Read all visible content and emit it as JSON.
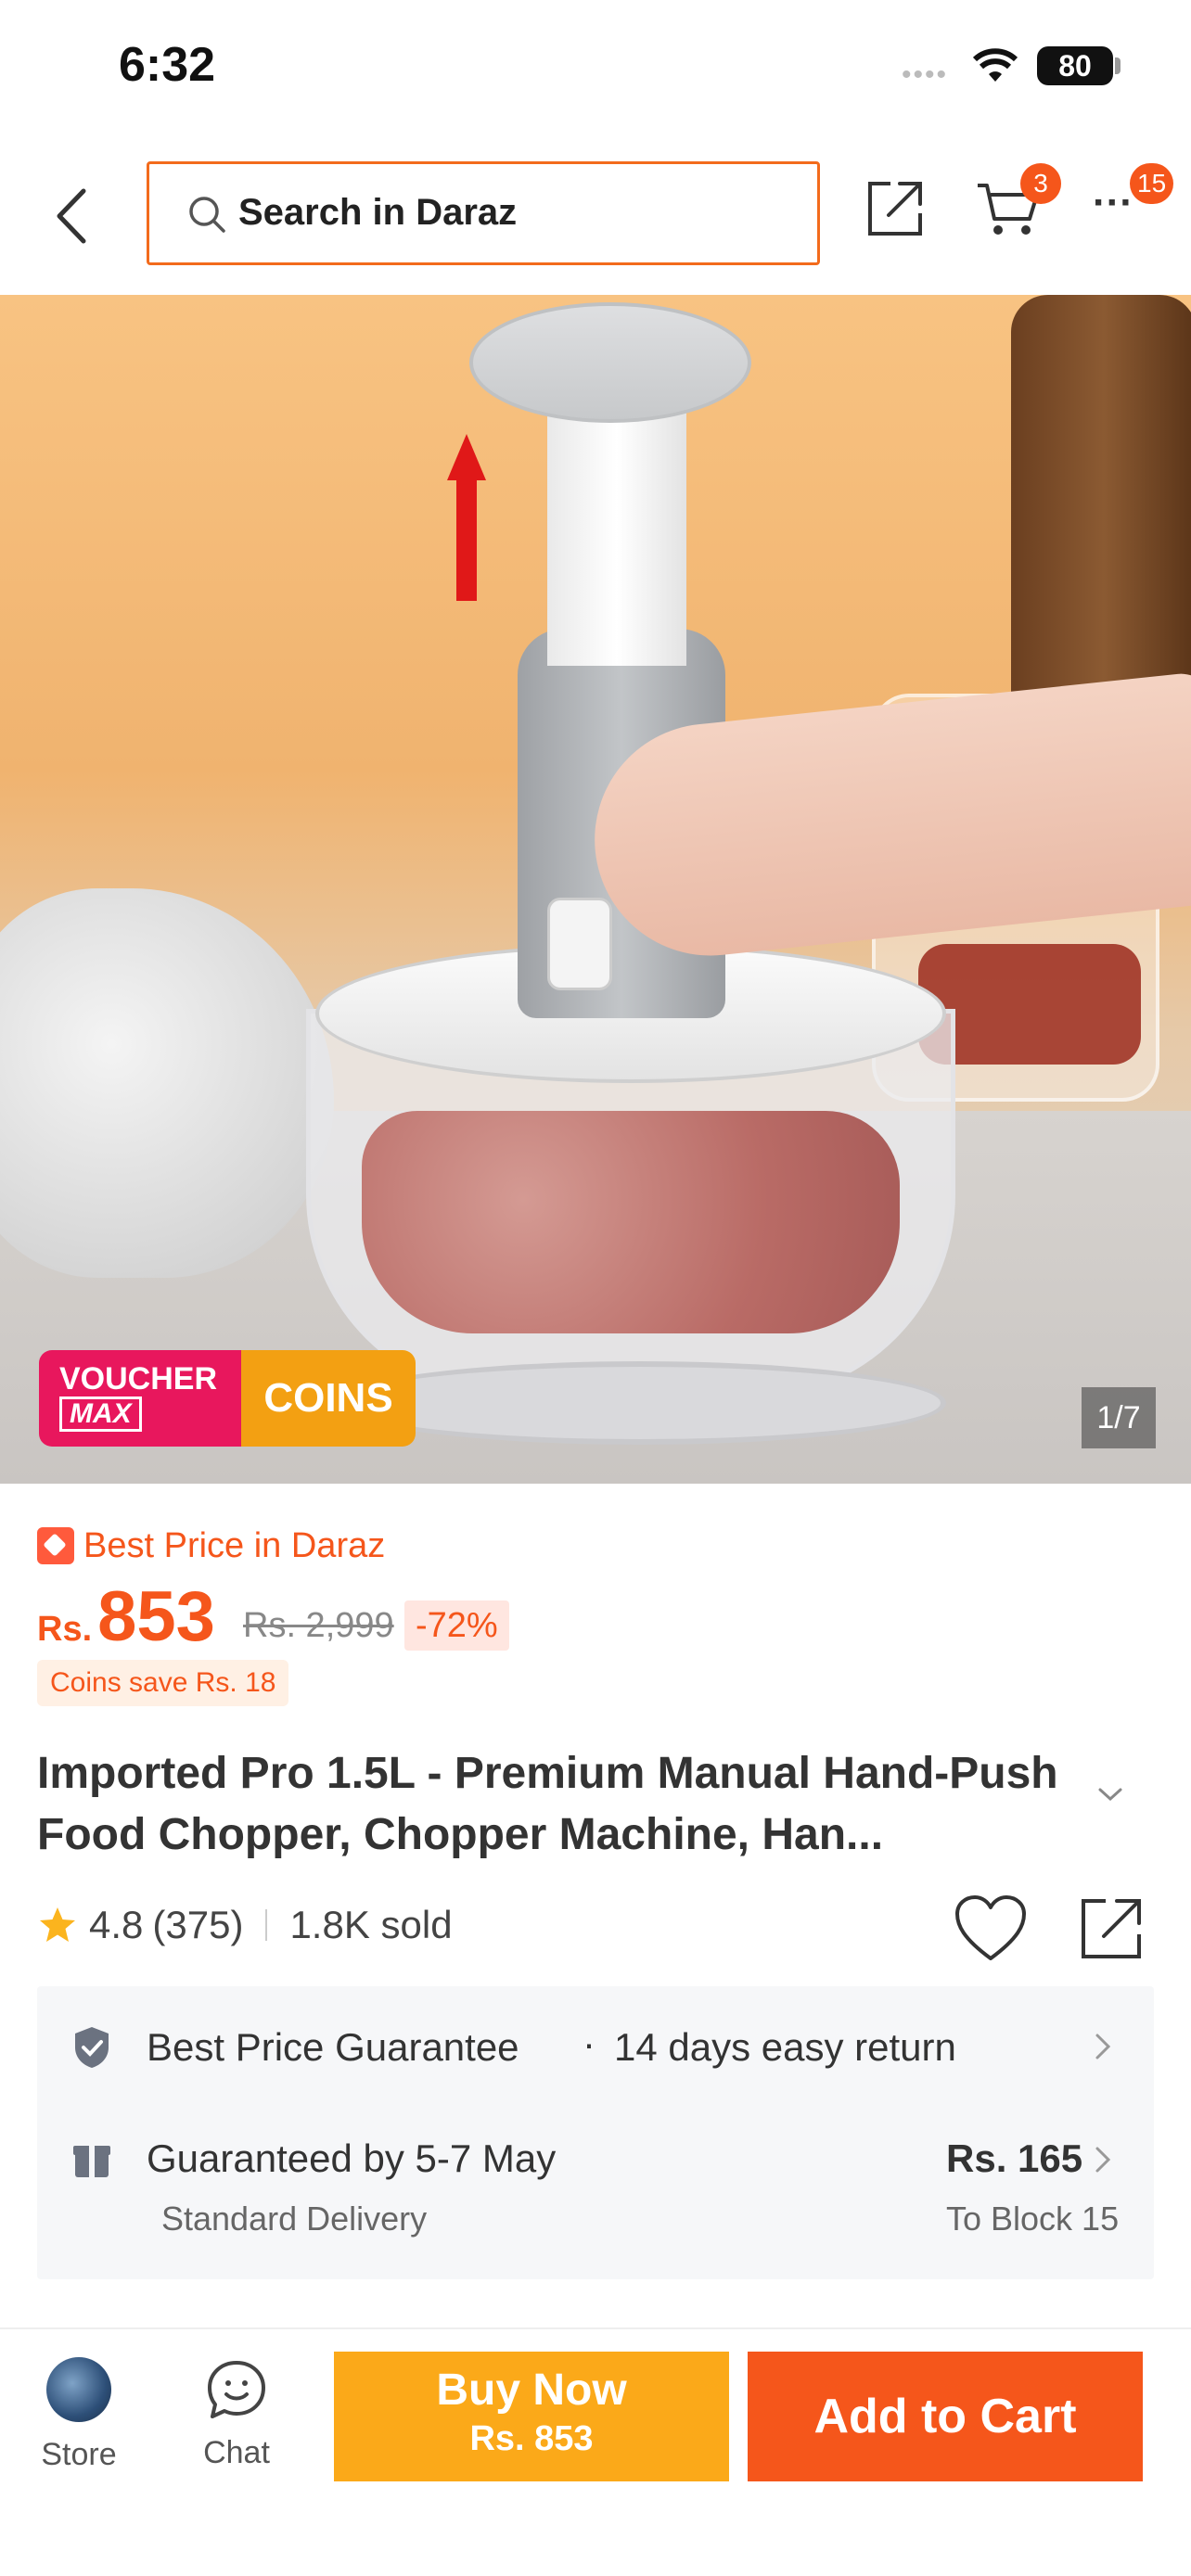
{
  "status_bar": {
    "time": "6:32",
    "battery": "80"
  },
  "header": {
    "search_placeholder": "Search in Daraz",
    "cart_badge": "3",
    "more_badge": "15"
  },
  "gallery": {
    "voucher_line1": "VOUCHER",
    "voucher_line2": "MAX",
    "coins_label": "COINS",
    "counter": "1/7"
  },
  "pricing": {
    "best_price_label": "Best Price in Daraz",
    "currency": "Rs.",
    "price": "853",
    "original_price": "Rs. 2,999",
    "discount": "-72%",
    "coins_save": "Coins save Rs. 18"
  },
  "product": {
    "title": "Imported  Pro 1.5L - Premium Manual Hand-Push Food Chopper, Chopper Machine, Han...",
    "rating": "4.8",
    "rating_count": "(375)",
    "sold": "1.8K sold"
  },
  "services": {
    "guarantee": "Best Price Guarantee",
    "return_policy": "14 days easy return",
    "delivery_date": "Guaranteed by 5-7 May",
    "delivery_type": "Standard Delivery",
    "delivery_fee": "Rs. 165",
    "delivery_to": "To Block 15"
  },
  "bottom_bar": {
    "store_label": "Store",
    "chat_label": "Chat",
    "buy_now_label": "Buy Now",
    "buy_now_price": "Rs. 853",
    "add_to_cart_label": "Add to Cart"
  },
  "colors": {
    "accent": "#f5561b",
    "buy_now": "#fba919"
  }
}
